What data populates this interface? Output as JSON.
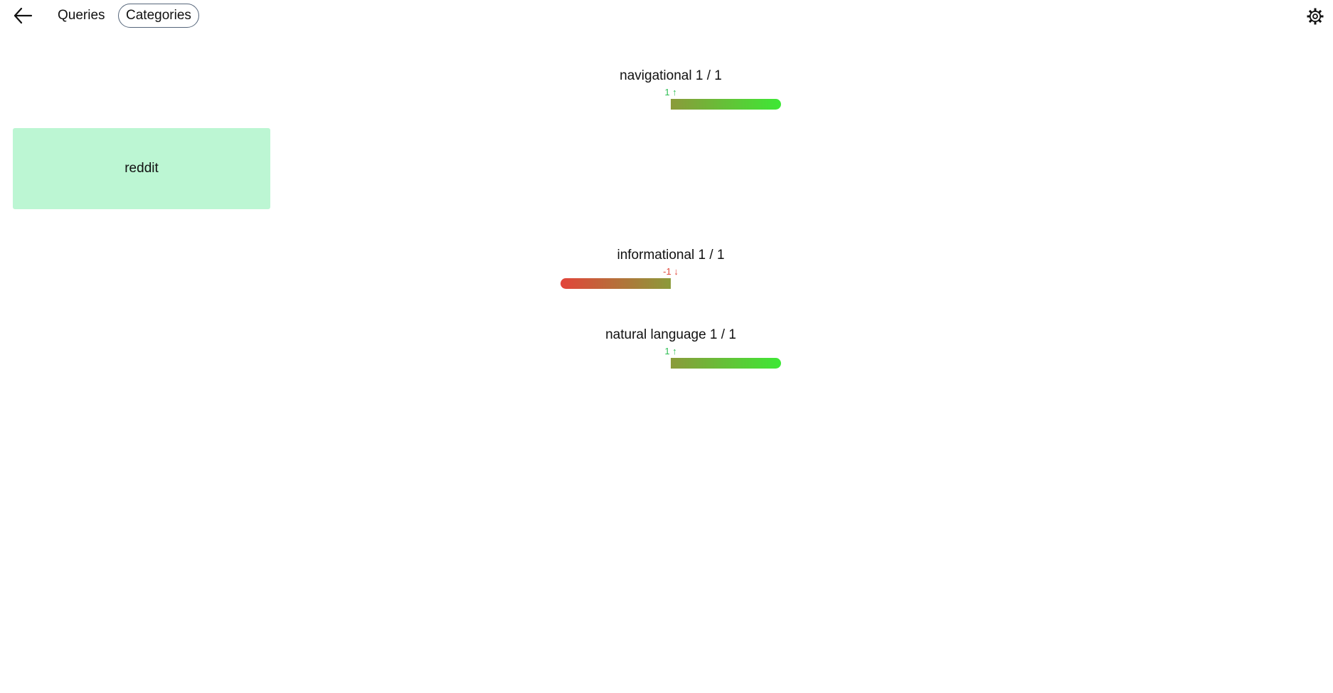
{
  "header": {
    "tabs": [
      {
        "label": "Queries",
        "selected": false
      },
      {
        "label": "Categories",
        "selected": true
      }
    ],
    "back_icon": "arrow-left-icon",
    "settings_icon": "gear-icon"
  },
  "queries": [
    {
      "label": "reddit"
    }
  ],
  "categories": [
    {
      "title": "navigational 1 / 1",
      "delta": "1 ↑",
      "direction": "up",
      "score": 1
    },
    {
      "title": "informational 1 / 1",
      "delta": "-1 ↓",
      "direction": "down",
      "score": -1
    },
    {
      "title": "natural language 1 / 1",
      "delta": "1 ↑",
      "direction": "up",
      "score": 1
    }
  ],
  "colors": {
    "accent_up": "#2fbf55",
    "accent_down": "#e0473a",
    "card_bg": "#bcf6d3",
    "bar_mid": "#8b9a3a",
    "bar_up_end": "#3de835",
    "bar_down_end": "#e2443a"
  }
}
